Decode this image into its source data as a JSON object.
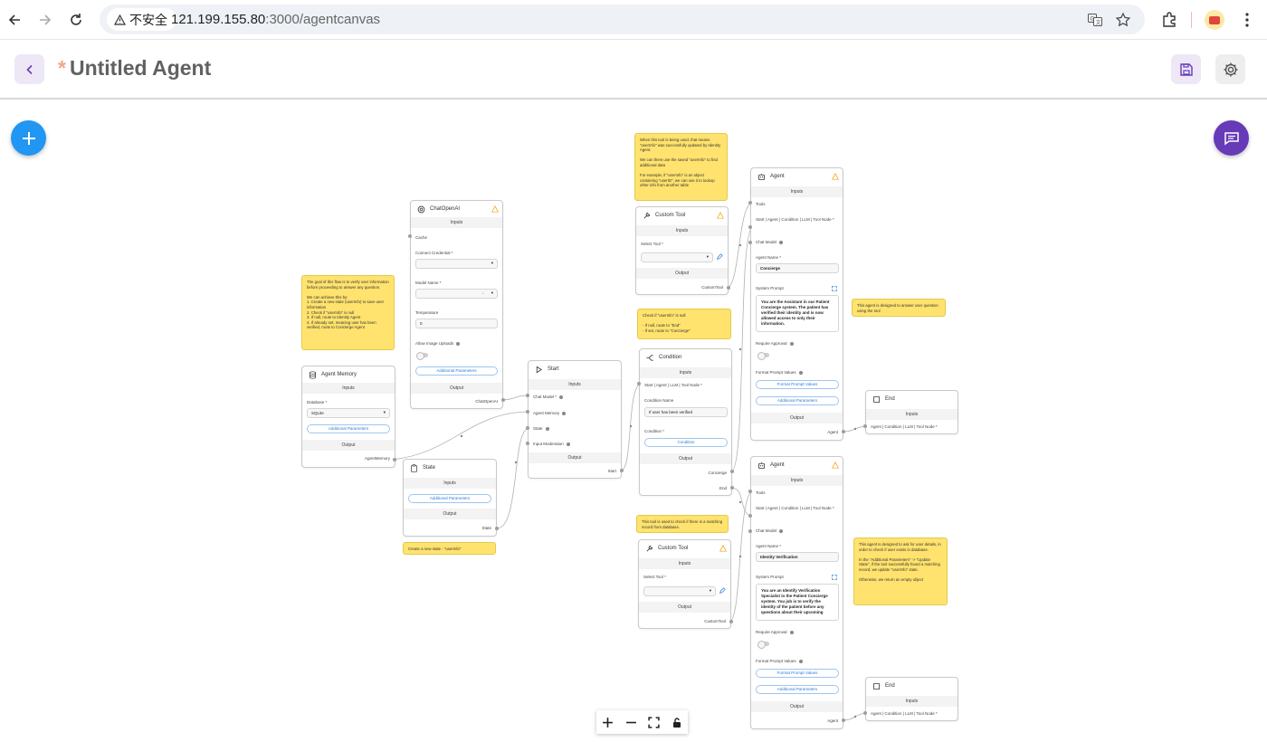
{
  "browser": {
    "security_label": "不安全",
    "url_host": "121.199.155.80",
    "url_path": ":3000/agentcanvas"
  },
  "header": {
    "dirty_mark": "*",
    "title": "Untitled Agent"
  },
  "colors": {
    "accent": "#673ab7",
    "fab_blue": "#2196f3",
    "note_yellow": "#ffe36e"
  },
  "nodes": {
    "chat_openai": {
      "title": "ChatOpenAI",
      "inputs": "Inputs",
      "cache": "Cache",
      "credential_label": "Connect Credential *",
      "model_label": "Model Name *",
      "temperature_label": "Temperature",
      "temperature_value": "0",
      "image_uploads_label": "Allow Image Uploads",
      "additional": "Additional Parameters",
      "output": "Output",
      "output_port": "ChatOpenAI"
    },
    "agent_memory": {
      "title": "Agent Memory",
      "inputs": "Inputs",
      "database_label": "Database *",
      "database_value": "SQLite",
      "additional": "Additional Parameters",
      "output": "Output",
      "output_port": "AgentMemory"
    },
    "state": {
      "title": "State",
      "inputs": "Inputs",
      "additional": "Additional Parameters",
      "output": "Output",
      "output_port": "State"
    },
    "start": {
      "title": "Start",
      "inputs": "Inputs",
      "chat_model": "Chat Model *",
      "agent_memory": "Agent Memory",
      "state": "State",
      "input_moderation": "Input Moderation",
      "output": "Output",
      "output_port": "Start"
    },
    "custom_tool_1": {
      "title": "Custom Tool",
      "inputs": "Inputs",
      "select_label": "Select Tool *",
      "output": "Output",
      "output_port": "CustomTool"
    },
    "condition": {
      "title": "Condition",
      "inputs": "Inputs",
      "start_input": "Start | Agent | LLM | Tool Node *",
      "name_label": "Condition Name",
      "name_value": "If user has been verified",
      "cond_label": "Condition *",
      "cond_button": "Condition",
      "output": "Output",
      "port_concierge": "Concierge",
      "port_end": "End"
    },
    "agent_1": {
      "title": "Agent",
      "inputs": "Inputs",
      "tools": "Tools",
      "start_input": "Start | Agent | Condition | LLM | Tool Node *",
      "chat_model": "Chat Model",
      "name_label": "Agent Name *",
      "name_value": "Concierge",
      "system_prompt_label": "System Prompt",
      "system_prompt": "You are the Assistant in our Patient Concierge system. The patient has verified their identity and is now allowed access to only their information.",
      "require_approval": "Require Approval",
      "format_label": "Format Prompt Values",
      "format_button": "Format Prompt Values",
      "additional": "Additional Parameters",
      "output": "Output",
      "output_port": "Agent"
    },
    "end_1": {
      "title": "End",
      "inputs": "Inputs",
      "input": "Agent | Condition | LLM | Tool Node *"
    },
    "agent_2": {
      "title": "Agent",
      "inputs": "Inputs",
      "tools": "Tools",
      "start_input": "Start | Agent | Condition | LLM | Tool Node *",
      "chat_model": "Chat Model",
      "name_label": "Agent Name *",
      "name_value": "Identity Verification",
      "system_prompt_label": "System Prompt",
      "system_prompt": "You are an Identify Verification Specialist in the Patient Concierge system. You job is to verify the identity of the patient before any questions about their upcoming",
      "require_approval": "Require Approval",
      "format_label": "Format Prompt Values",
      "format_button": "Format Prompt Values",
      "additional": "Additional Parameters",
      "output": "Output",
      "output_port": "Agent"
    },
    "custom_tool_2": {
      "title": "Custom Tool",
      "inputs": "Inputs",
      "select_label": "Select Tool *",
      "output": "Output",
      "output_port": "CustomTool"
    },
    "end_2": {
      "title": "End",
      "inputs": "Inputs",
      "input": "Agent | Condition | LLM | Tool Node *"
    }
  },
  "notes": {
    "goal": "The goal of this flow is to verify user information before proceeding to answer any question.\n\nWe can achieve this by:\n1. Create a new state (userInfo) to save user information\n2. Check if \"userInfo\" is null\n3. If null, route to Identity Agent\n4. If already set, meaning user has been verified, route to Concierge Agent",
    "tool_used": "When this tool is being used, that means \"userInfo\" was successfully updated by Identity Agent.\n\nWe can them use the saved \"userInfo\" to find additional data\n\nFor example, if \"userInfo\" is an object containing \"userID\", we can use it to lookup other info from another table",
    "check_null": "Check if \"userInfo\" is null\n\n- If null, route to \"End\"\n- If set, route to \"Concierge\"",
    "answer_agent": "This agent is designed to answer user question using the tool",
    "check_db": "This tool is used to check if there is a matching record from database.",
    "state_note": "Create a new state - \"userInfo\"",
    "identity_agent": "This agent is designed to ask for user details, in order to check if user exists in database.\n\nIn the \"Additional Parameters\" -> \"Update State\", if the tool successfully found a matching record, we update \"userInfo\" state.\n\nOtherwise, we return an empty object"
  }
}
